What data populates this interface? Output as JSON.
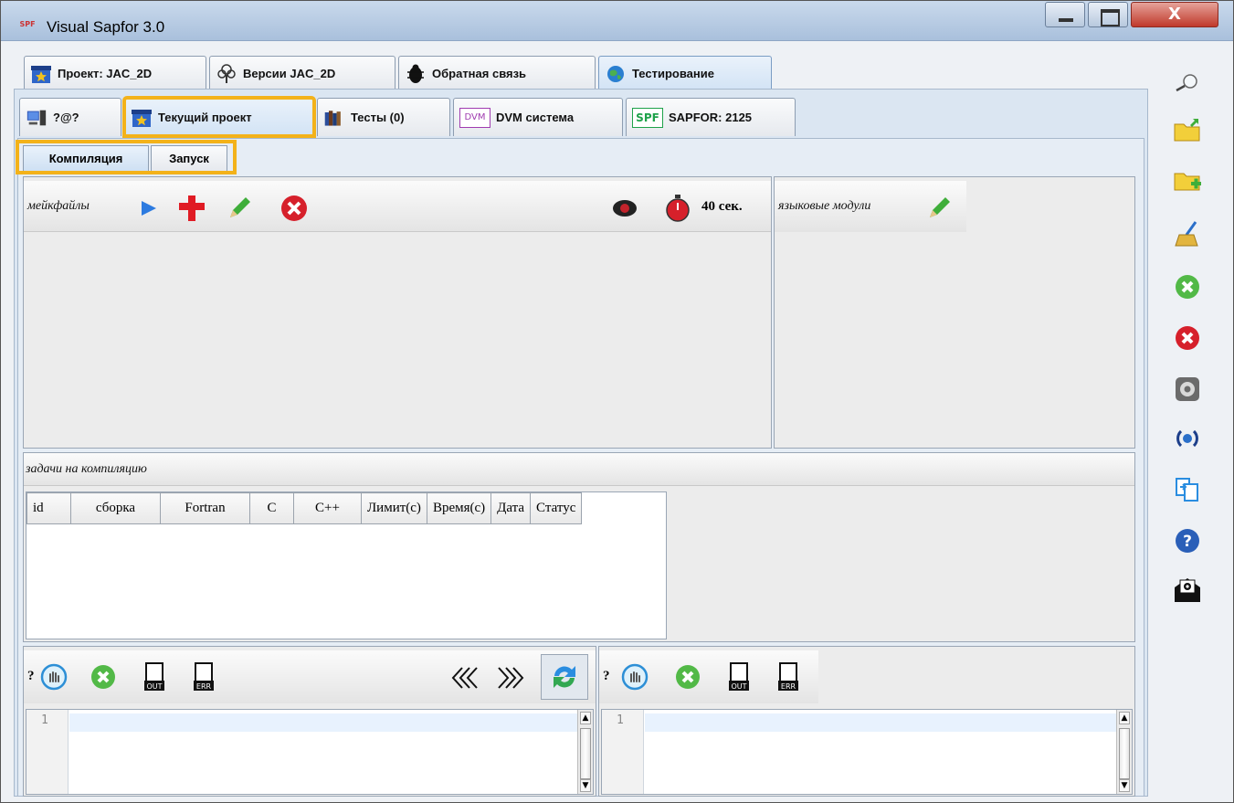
{
  "window": {
    "title": "Visual Sapfor 3.0",
    "app_icon_text": "SPF",
    "close_label": "X"
  },
  "main_tabs": [
    {
      "label": "Проект: JAC_2D",
      "icon": "project-star-icon"
    },
    {
      "label": "Версии JAC_2D",
      "icon": "tree-versions-icon"
    },
    {
      "label": "Обратная связь",
      "icon": "bug-icon"
    },
    {
      "label": "Тестирование",
      "icon": "globe-icon",
      "active": true
    }
  ],
  "sub_tabs": [
    {
      "label": "?@?",
      "icon": "computer-icon"
    },
    {
      "label": "Текущий проект",
      "icon": "project-star-icon",
      "active": true
    },
    {
      "label": "Тесты (0)",
      "icon": "books-icon"
    },
    {
      "label": "DVM система",
      "icon": "dvm-icon",
      "icon_text": "DVM"
    },
    {
      "label": "SAPFOR: 2125",
      "icon": "spf-icon",
      "icon_text": "SPF"
    }
  ],
  "inner_tabs": [
    {
      "label": "Компиляция",
      "active": true
    },
    {
      "label": "Запуск"
    }
  ],
  "makefiles": {
    "title": "мейкфайлы",
    "timeout_label": "40 сек."
  },
  "modules": {
    "title": "языковые модули"
  },
  "tasks": {
    "title": "задачи на компиляцию",
    "columns": [
      "id",
      "сборка",
      "Fortran",
      "C",
      "C++",
      "Лимит(с)",
      "Время(с)",
      "Дата",
      "Статус"
    ]
  },
  "output_left": {
    "label": "?",
    "line_number": "1"
  },
  "output_right": {
    "label": "?",
    "line_number": "1"
  },
  "colors": {
    "highlight": "#f3b21a",
    "title_bar": "#b8cde6",
    "close_button": "#c0392b"
  }
}
